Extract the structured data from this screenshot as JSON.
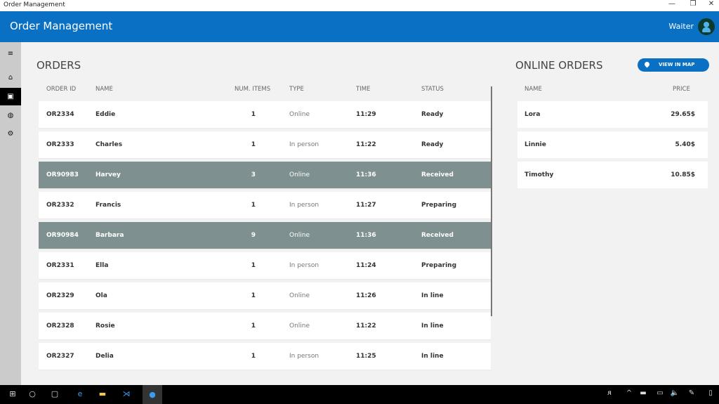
{
  "window": {
    "title": "Order Management",
    "min": "—",
    "restore": "❐",
    "close": "✕"
  },
  "header": {
    "title": "Order Management",
    "user": "Waiter"
  },
  "sidebar": [
    {
      "icon": "menu-icon",
      "glyph": "≡"
    },
    {
      "icon": "home-icon",
      "glyph": "⌂"
    },
    {
      "icon": "briefcase-icon",
      "glyph": "▣"
    },
    {
      "icon": "globe-icon",
      "glyph": "◍"
    },
    {
      "icon": "gear-icon",
      "glyph": "⚙"
    }
  ],
  "orders": {
    "title": "ORDERS",
    "columns": [
      "ORDER ID",
      "NAME",
      "NUM. ITEMS",
      "TYPE",
      "TIME",
      "STATUS"
    ],
    "rows": [
      {
        "id": "OR2334",
        "name": "Eddie",
        "items": "1",
        "type": "Online",
        "time": "11:29",
        "status": "Ready",
        "hl": false
      },
      {
        "id": "OR2333",
        "name": "Charles",
        "items": "1",
        "type": "In person",
        "time": "11:22",
        "status": "Ready",
        "hl": false
      },
      {
        "id": "OR90983",
        "name": "Harvey",
        "items": "3",
        "type": "Online",
        "time": "11:36",
        "status": "Received",
        "hl": true
      },
      {
        "id": "OR2332",
        "name": "Francis",
        "items": "1",
        "type": "In person",
        "time": "11:27",
        "status": "Preparing",
        "hl": false
      },
      {
        "id": "OR90984",
        "name": "Barbara",
        "items": "9",
        "type": "Online",
        "time": "11:36",
        "status": "Received",
        "hl": true
      },
      {
        "id": "OR2331",
        "name": "Ella",
        "items": "1",
        "type": "In person",
        "time": "11:24",
        "status": "Preparing",
        "hl": false
      },
      {
        "id": "OR2329",
        "name": "Ola",
        "items": "1",
        "type": "Online",
        "time": "11:26",
        "status": "In line",
        "hl": false
      },
      {
        "id": "OR2328",
        "name": "Rosie",
        "items": "1",
        "type": "Online",
        "time": "11:22",
        "status": "In line",
        "hl": false
      },
      {
        "id": "OR2327",
        "name": "Delia",
        "items": "1",
        "type": "In person",
        "time": "11:25",
        "status": "In line",
        "hl": false
      }
    ]
  },
  "online": {
    "title": "ONLINE ORDERS",
    "map_button": "VIEW IN MAP",
    "columns": [
      "NAME",
      "PRICE"
    ],
    "rows": [
      {
        "name": "Lora",
        "price": "29.65$"
      },
      {
        "name": "Linnie",
        "price": "5.40$"
      },
      {
        "name": "Timothy",
        "price": "10.85$"
      }
    ]
  },
  "taskbar": [
    {
      "icon": "windows-start-icon",
      "glyph": "⊞"
    },
    {
      "icon": "cortana-icon",
      "glyph": "○"
    },
    {
      "icon": "task-view-icon",
      "glyph": "▢"
    },
    {
      "icon": "edge-icon",
      "glyph": "e"
    },
    {
      "icon": "file-explorer-icon",
      "glyph": "▬"
    },
    {
      "icon": "visual-studio-icon",
      "glyph": "⋊"
    },
    {
      "icon": "app-icon",
      "glyph": "●"
    }
  ],
  "tray": [
    {
      "icon": "people-icon",
      "glyph": "ᴙ"
    },
    {
      "icon": "chevron-up-icon",
      "glyph": "^"
    },
    {
      "icon": "battery-icon",
      "glyph": "▬"
    },
    {
      "icon": "network-icon",
      "glyph": "▭"
    },
    {
      "icon": "volume-icon",
      "glyph": "🔈"
    },
    {
      "icon": "pen-icon",
      "glyph": "✎"
    },
    {
      "icon": "notifications-icon",
      "glyph": "▯"
    }
  ]
}
